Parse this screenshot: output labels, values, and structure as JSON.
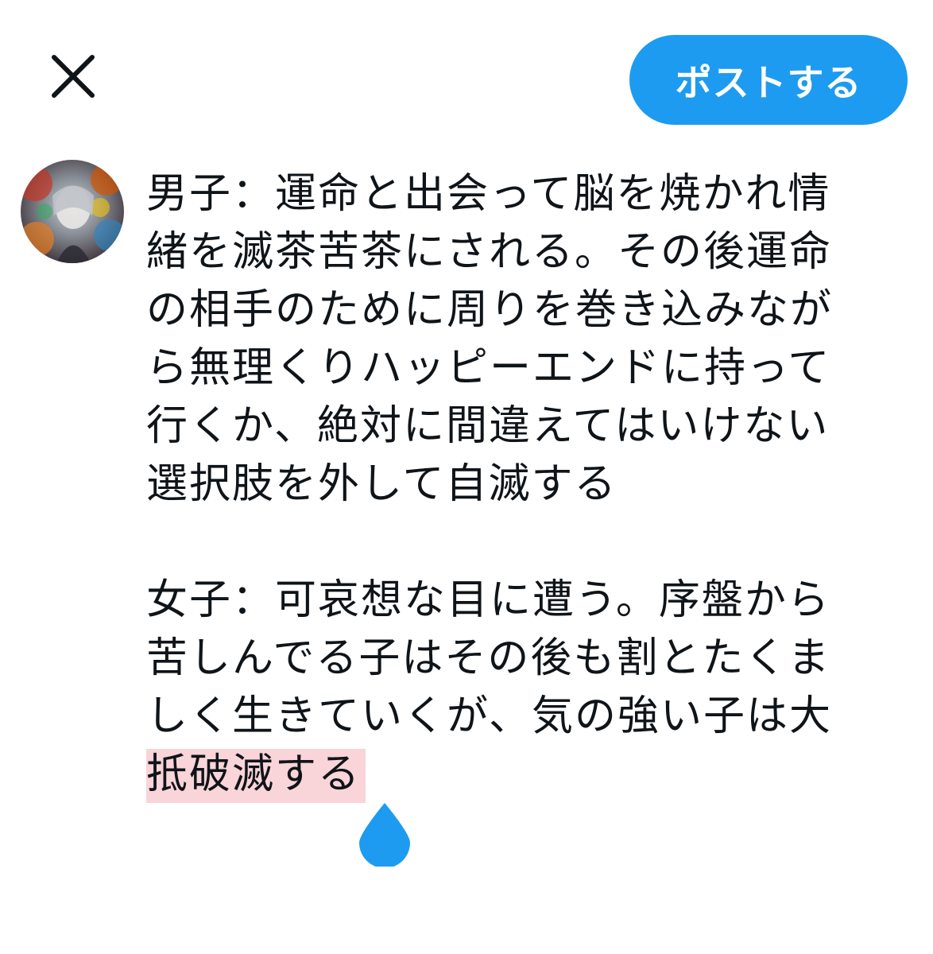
{
  "header": {
    "close_icon": "close-icon",
    "post_label": "ポストする",
    "accent_color": "#1d9bf0"
  },
  "composer": {
    "lines_para1": [
      "男子：運命と出会って脳を焼かれ情",
      "緒を滅茶苦茶にされる。その後運命",
      "の相手のために周りを巻き込みなが",
      "ら無理くりハッピーエンドに持って",
      "行くか、絶対に間違えてはいけない",
      "選択肢を外して自滅する"
    ],
    "lines_para2": [
      "女子：可哀想な目に遭う。序盤から",
      "苦しんでる子はその後も割とたくま",
      "しく生きていくが、気の強い子は大"
    ],
    "selected_text": "抵破滅する",
    "selection_color": "#f9d4d8"
  }
}
